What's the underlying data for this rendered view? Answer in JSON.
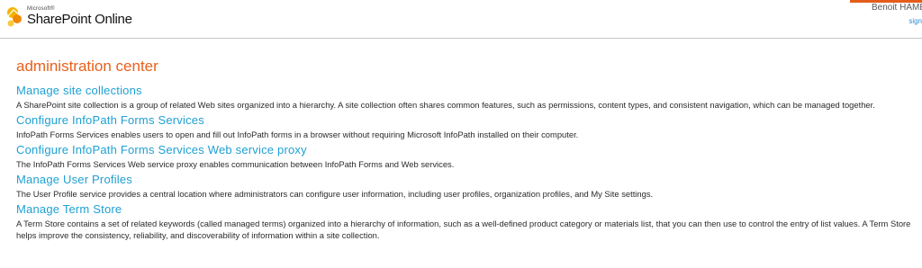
{
  "header": {
    "logo_small": "Microsoft®",
    "logo_main": "SharePoint Online",
    "user_name": "Benoit HAME",
    "sign_link": "sign",
    "accent_color": "#e35d19"
  },
  "page": {
    "title": "administration center",
    "sections": [
      {
        "link": "Manage site collections",
        "description": "A SharePoint site collection is a group of related Web sites organized into a hierarchy. A site collection often shares common features, such as permissions, content types, and consistent navigation, which can be managed together."
      },
      {
        "link": "Configure InfoPath Forms Services",
        "description": "InfoPath Forms Services enables users to open and fill out InfoPath forms in a browser without requiring Microsoft InfoPath installed on their computer."
      },
      {
        "link": "Configure InfoPath Forms Services Web service proxy",
        "description": "The InfoPath Forms Services Web service proxy enables communication between InfoPath Forms and Web services."
      },
      {
        "link": "Manage User Profiles",
        "description": "The User Profile service provides a central location where administrators can configure user information, including user profiles, organization profiles, and My Site settings."
      },
      {
        "link": "Manage Term Store",
        "description": "A Term Store contains a set of related keywords (called managed terms) organized into a hierarchy of information, such as a well-defined product category or materials list, that you can then use to control the entry of list values. A Term Store helps improve the consistency, reliability, and discoverability of information within a site collection."
      }
    ]
  }
}
